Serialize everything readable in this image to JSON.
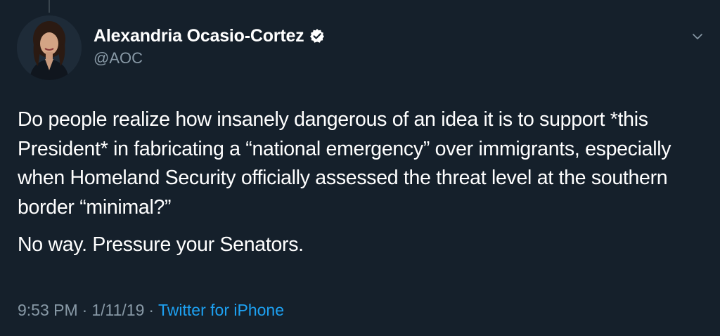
{
  "tweet": {
    "display_name": "Alexandria Ocasio-Cortez",
    "handle": "@AOC",
    "verified": true,
    "paragraphs": [
      "Do people realize how insanely dangerous of an idea it is to support *this President* in fabricating a “national emergency” over immigrants, especially when Homeland Security officially assessed the threat level at the southern border “minimal?”",
      "No way. Pressure your Senators."
    ],
    "time": "9:53 PM",
    "separator": "·",
    "date": "1/11/19",
    "source": "Twitter for iPhone"
  },
  "colors": {
    "background": "#15202b",
    "text": "#ffffff",
    "secondary": "#8899a6",
    "accent": "#1da1f2"
  },
  "icons": {
    "verified": "verified-badge-icon",
    "menu": "chevron-down-icon",
    "thread": "thread-line"
  }
}
